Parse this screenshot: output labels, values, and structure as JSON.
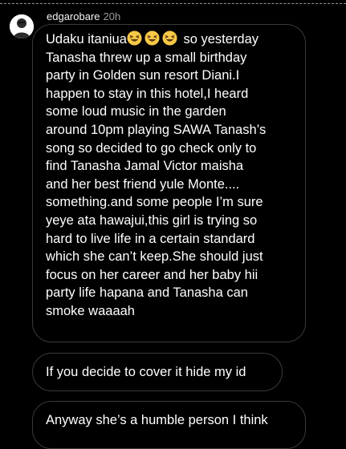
{
  "post": {
    "username": "edgarobare",
    "timestamp": "20h"
  },
  "messages": [
    {
      "lead": "Udaku itaniua",
      "emojis": [
        "laughing-emoji",
        "laughing-emoji",
        "laughing-emoji"
      ],
      "text": " so yesterday\nTanasha threw up a small birthday\nparty in Golden sun resort Diani.I\nhappen to stay in this hotel,I heard\nsome loud music in the garden\naround 10pm playing SAWA Tanash’s\nsong so decided to go check only to\nfind Tanasha Jamal Victor maisha\nand her best friend yule Monte....\nsomething.and some people I’m sure\nyeye ata hawajui,this girl is trying so\nhard to live life in a certain standard\nwhich she can’t keep.She should just\nfocus on her career and her baby hii\nparty life hapana and Tanasha can\nsmoke waaaah"
    },
    {
      "text": "If you decide to cover it hide my id"
    },
    {
      "text": "Anyway she’s a humble person I think"
    }
  ],
  "colors": {
    "background": "#000000",
    "bubble_border": "#3a3a3a",
    "text": "#ffffff",
    "timestamp": "#9b9b9b",
    "emoji": "#f7c948"
  }
}
